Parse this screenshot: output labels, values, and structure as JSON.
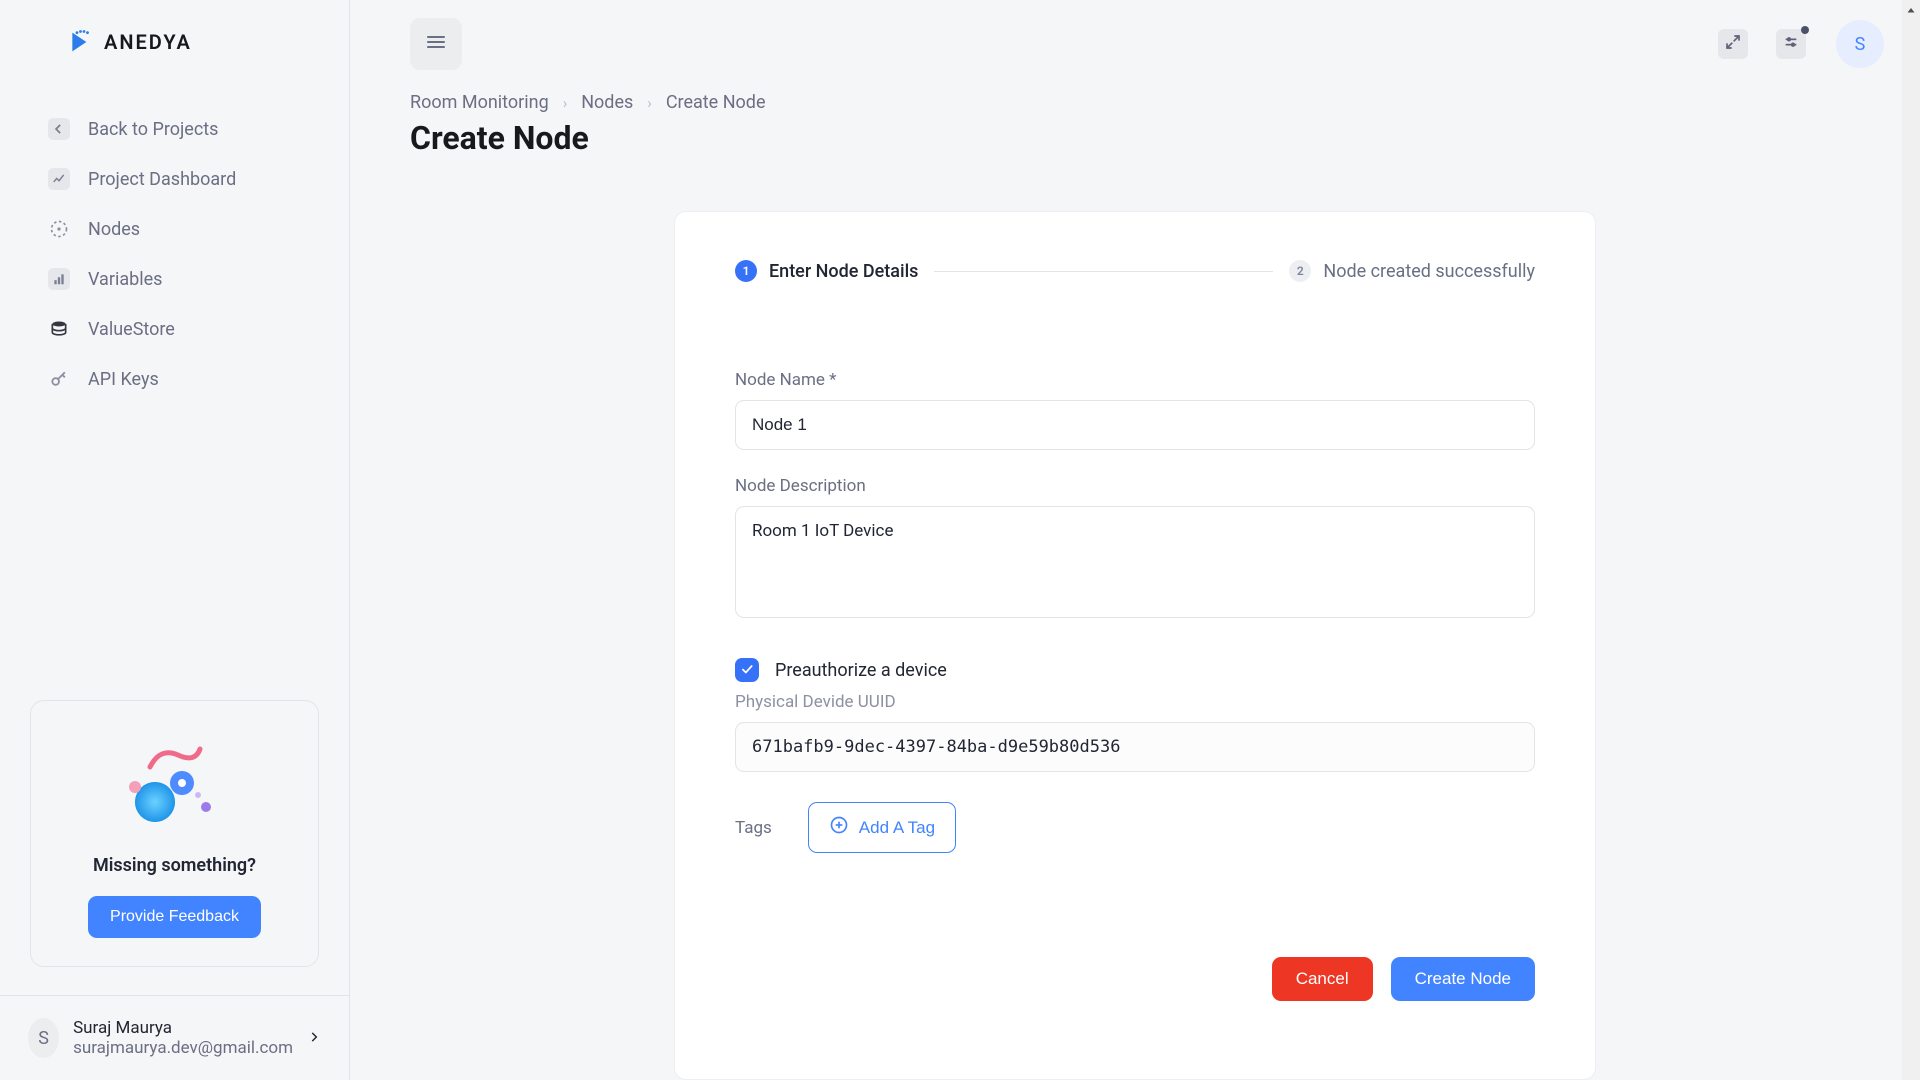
{
  "brand": {
    "name": "ANEDYA"
  },
  "sidebar": {
    "items": [
      {
        "label": "Back to Projects"
      },
      {
        "label": "Project Dashboard"
      },
      {
        "label": "Nodes"
      },
      {
        "label": "Variables"
      },
      {
        "label": "ValueStore"
      },
      {
        "label": "API Keys"
      }
    ],
    "feedback": {
      "title": "Missing something?",
      "button": "Provide Feedback"
    },
    "user": {
      "initial": "S",
      "name": "Suraj Maurya",
      "email": "surajmaurya.dev@gmail.com"
    }
  },
  "topbar": {
    "avatar_initial": "S"
  },
  "breadcrumb": {
    "items": [
      "Room Monitoring",
      "Nodes",
      "Create Node"
    ]
  },
  "page": {
    "title": "Create Node"
  },
  "stepper": {
    "step1_num": "1",
    "step1_label": "Enter Node Details",
    "step2_num": "2",
    "step2_label": "Node created successfully"
  },
  "form": {
    "name_label": "Node Name *",
    "name_value": "Node 1",
    "desc_label": "Node Description",
    "desc_value": "Room 1 IoT Device",
    "preauth_label": "Preauthorize a device",
    "preauth_checked": true,
    "uuid_label": "Physical Devide UUID",
    "uuid_value": "671bafb9-9dec-4397-84ba-d9e59b80d536",
    "tags_label": "Tags",
    "add_tag_label": "Add A Tag"
  },
  "actions": {
    "cancel": "Cancel",
    "submit": "Create Node"
  }
}
